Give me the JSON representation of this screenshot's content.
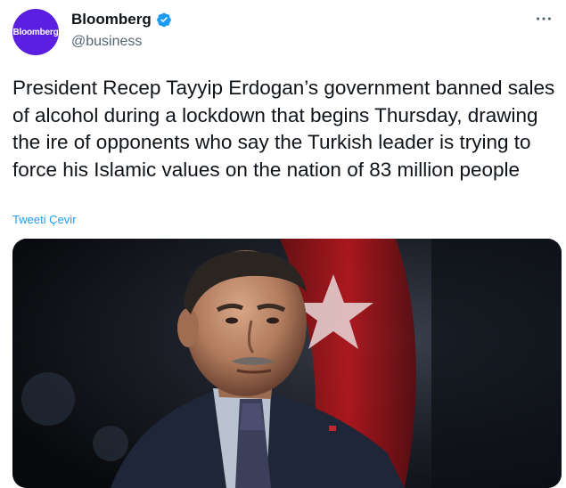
{
  "tweet": {
    "avatar_text": "Bloomberg",
    "author_name": "Bloomberg",
    "handle": "@business",
    "more_icon": "more-horizontal-icon",
    "verified_icon": "verified-badge-icon",
    "body": "President Recep Tayyip Erdogan’s government banned sales of alcohol during a lockdown that begins Thursday, drawing the ire of opponents who say the Turkish leader is trying to force his Islamic values on the nation of 83 million people",
    "translate_label": "Tweeti Çevir",
    "media": "photo"
  },
  "colors": {
    "avatar_bg": "#5a1fe0",
    "link": "#1d9bf0",
    "verified": "#1d9bf0",
    "text": "#0f1419",
    "secondary": "#536471"
  }
}
